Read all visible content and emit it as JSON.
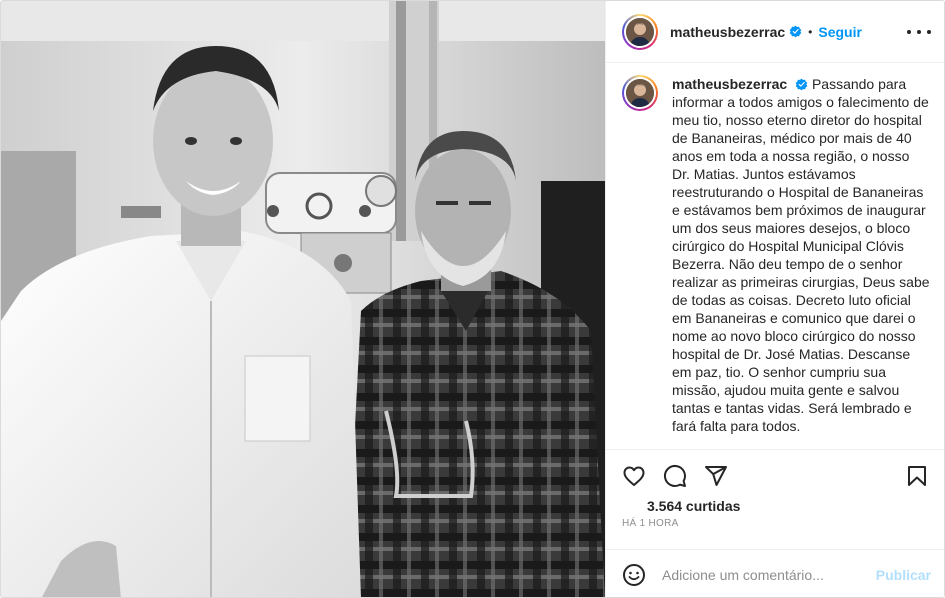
{
  "post": {
    "author": {
      "username": "matheusbezerrac",
      "verified": true,
      "avatar_icon": "profile-photo"
    },
    "header": {
      "dot": "•",
      "follow_label": "Seguir",
      "more_icon": "more-horizontal-icon"
    },
    "photo": {
      "description_icon": "photo-two-men-black-and-white"
    },
    "caption": {
      "username": "matheusbezerrac",
      "text": "Passando para informar a todos amigos o falecimento de meu tio, nosso eterno diretor do hospital de Bananeiras, médico por mais de 40 anos em toda a nossa região, o nosso Dr. Matias. Juntos estávamos reestruturando o Hospital de Bananeiras e estávamos bem próximos de inaugurar um dos seus maiores desejos, o bloco cirúrgico do Hospital Municipal Clóvis Bezerra. Não deu tempo de o senhor realizar as primeiras cirurgias, Deus sabe de todas as coisas. Decreto luto oficial em Bananeiras e comunico que darei o nome ao novo bloco cirúrgico do nosso hospital de Dr. José Matias. Descanse em paz, tio. O senhor cumpriu sua missão, ajudou muita gente e salvou tantas e tantas vidas. Será lembrado e fará falta para todos."
    },
    "actions": {
      "like_icon": "heart-icon",
      "comment_icon": "comment-icon",
      "share_icon": "share-icon",
      "save_icon": "bookmark-icon"
    },
    "likes": "3.564 curtidas",
    "time": "HÁ 1 HORA",
    "comment_box": {
      "emoji_icon": "emoji-icon",
      "placeholder": "Adicione um comentário...",
      "publish_label": "Publicar"
    },
    "colors": {
      "link_blue": "#0095f6",
      "publish_disabled": "#b2dffc",
      "text": "#262626",
      "muted": "#8e8e8e"
    }
  }
}
